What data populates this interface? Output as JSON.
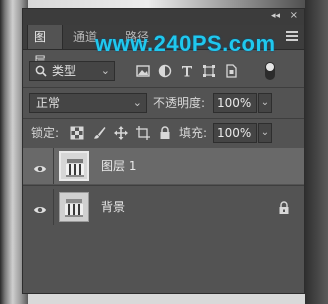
{
  "watermark": "www.240PS.com",
  "panel": {
    "collapse": "◂◂",
    "close": "×",
    "tabs": [
      "图层",
      "通道",
      "路径"
    ]
  },
  "filter": {
    "kind_label": "类型"
  },
  "blend": {
    "mode": "正常",
    "opacity_label": "不透明度:",
    "opacity_value": "100%"
  },
  "locks": {
    "label": "锁定:",
    "fill_label": "填充:",
    "fill_value": "100%"
  },
  "layers": [
    {
      "name": "图层 1",
      "selected": true
    },
    {
      "name": "背景",
      "locked": true
    }
  ],
  "colors": {
    "watermark": "#1fc8ee",
    "panel": "#535353",
    "selected_row": "#696969"
  }
}
